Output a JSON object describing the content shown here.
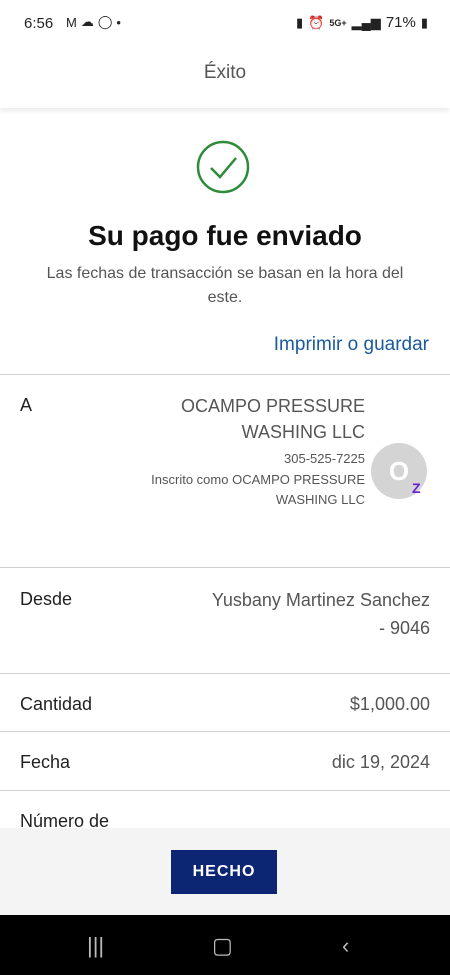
{
  "status_bar": {
    "time": "6:56",
    "network": "5G+",
    "battery": "71%"
  },
  "header": {
    "title": "Éxito"
  },
  "success": {
    "heading": "Su pago fue enviado",
    "subtext": "Las fechas de transacción se basan en la hora del este.",
    "print_link": "Imprimir o guardar"
  },
  "details": {
    "to": {
      "label": "A",
      "name": "OCAMPO PRESSURE WASHING LLC",
      "phone": "305-525-7225",
      "enrolled": "Inscrito como OCAMPO PRESSURE WASHING LLC",
      "avatar_initial": "O",
      "badge": "Z"
    },
    "from": {
      "label": "Desde",
      "value": "Yusbany Martinez Sanchez - 9046"
    },
    "amount": {
      "label": "Cantidad",
      "value": "$1,000.00"
    },
    "date": {
      "label": "Fecha",
      "value": "dic 19, 2024"
    },
    "number": {
      "label": "Número de"
    }
  },
  "footer": {
    "done_label": "HECHO"
  },
  "colors": {
    "success_green": "#2e8b3a",
    "link_blue": "#1a5a9c",
    "button_navy": "#0c2674",
    "zelle_purple": "#6d1ed4"
  }
}
